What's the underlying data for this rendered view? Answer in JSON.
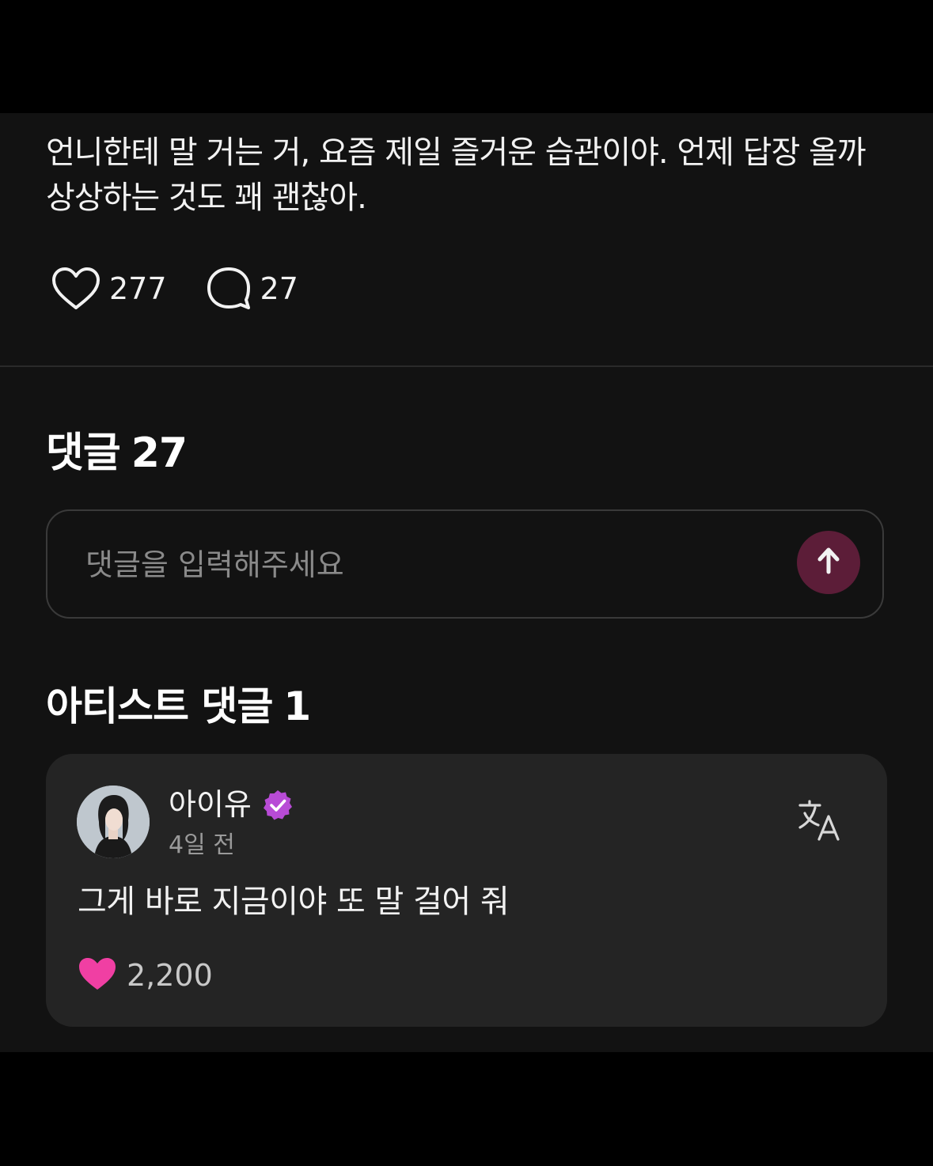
{
  "post": {
    "text": "언니한테 말 거는 거, 요즘 제일 즐거운 습관이야. 언제 답장 올까 상상하는 것도 꽤 괜찮아.",
    "likes": "277",
    "comments": "27"
  },
  "comments_section": {
    "title": "댓글",
    "count": "27",
    "placeholder": "댓글을 입력해주세요"
  },
  "artist_comments": {
    "title": "아티스트 댓글",
    "count": "1",
    "items": [
      {
        "author": "아이유",
        "time": "4일 전",
        "text": "그게 바로 지금이야 또 말 걸어 줘",
        "likes": "2,200"
      }
    ]
  },
  "colors": {
    "background": "#121212",
    "card": "#242424",
    "send_button": "#5c1d38",
    "verified_badge": "#b84bd6",
    "liked_heart": "#f03fa3"
  },
  "icons": {
    "like": "heart-outline-icon",
    "comment": "speech-bubble-icon",
    "send": "arrow-up-icon",
    "verified": "verified-badge-icon",
    "translate": "translate-icon",
    "liked": "heart-filled-icon"
  }
}
